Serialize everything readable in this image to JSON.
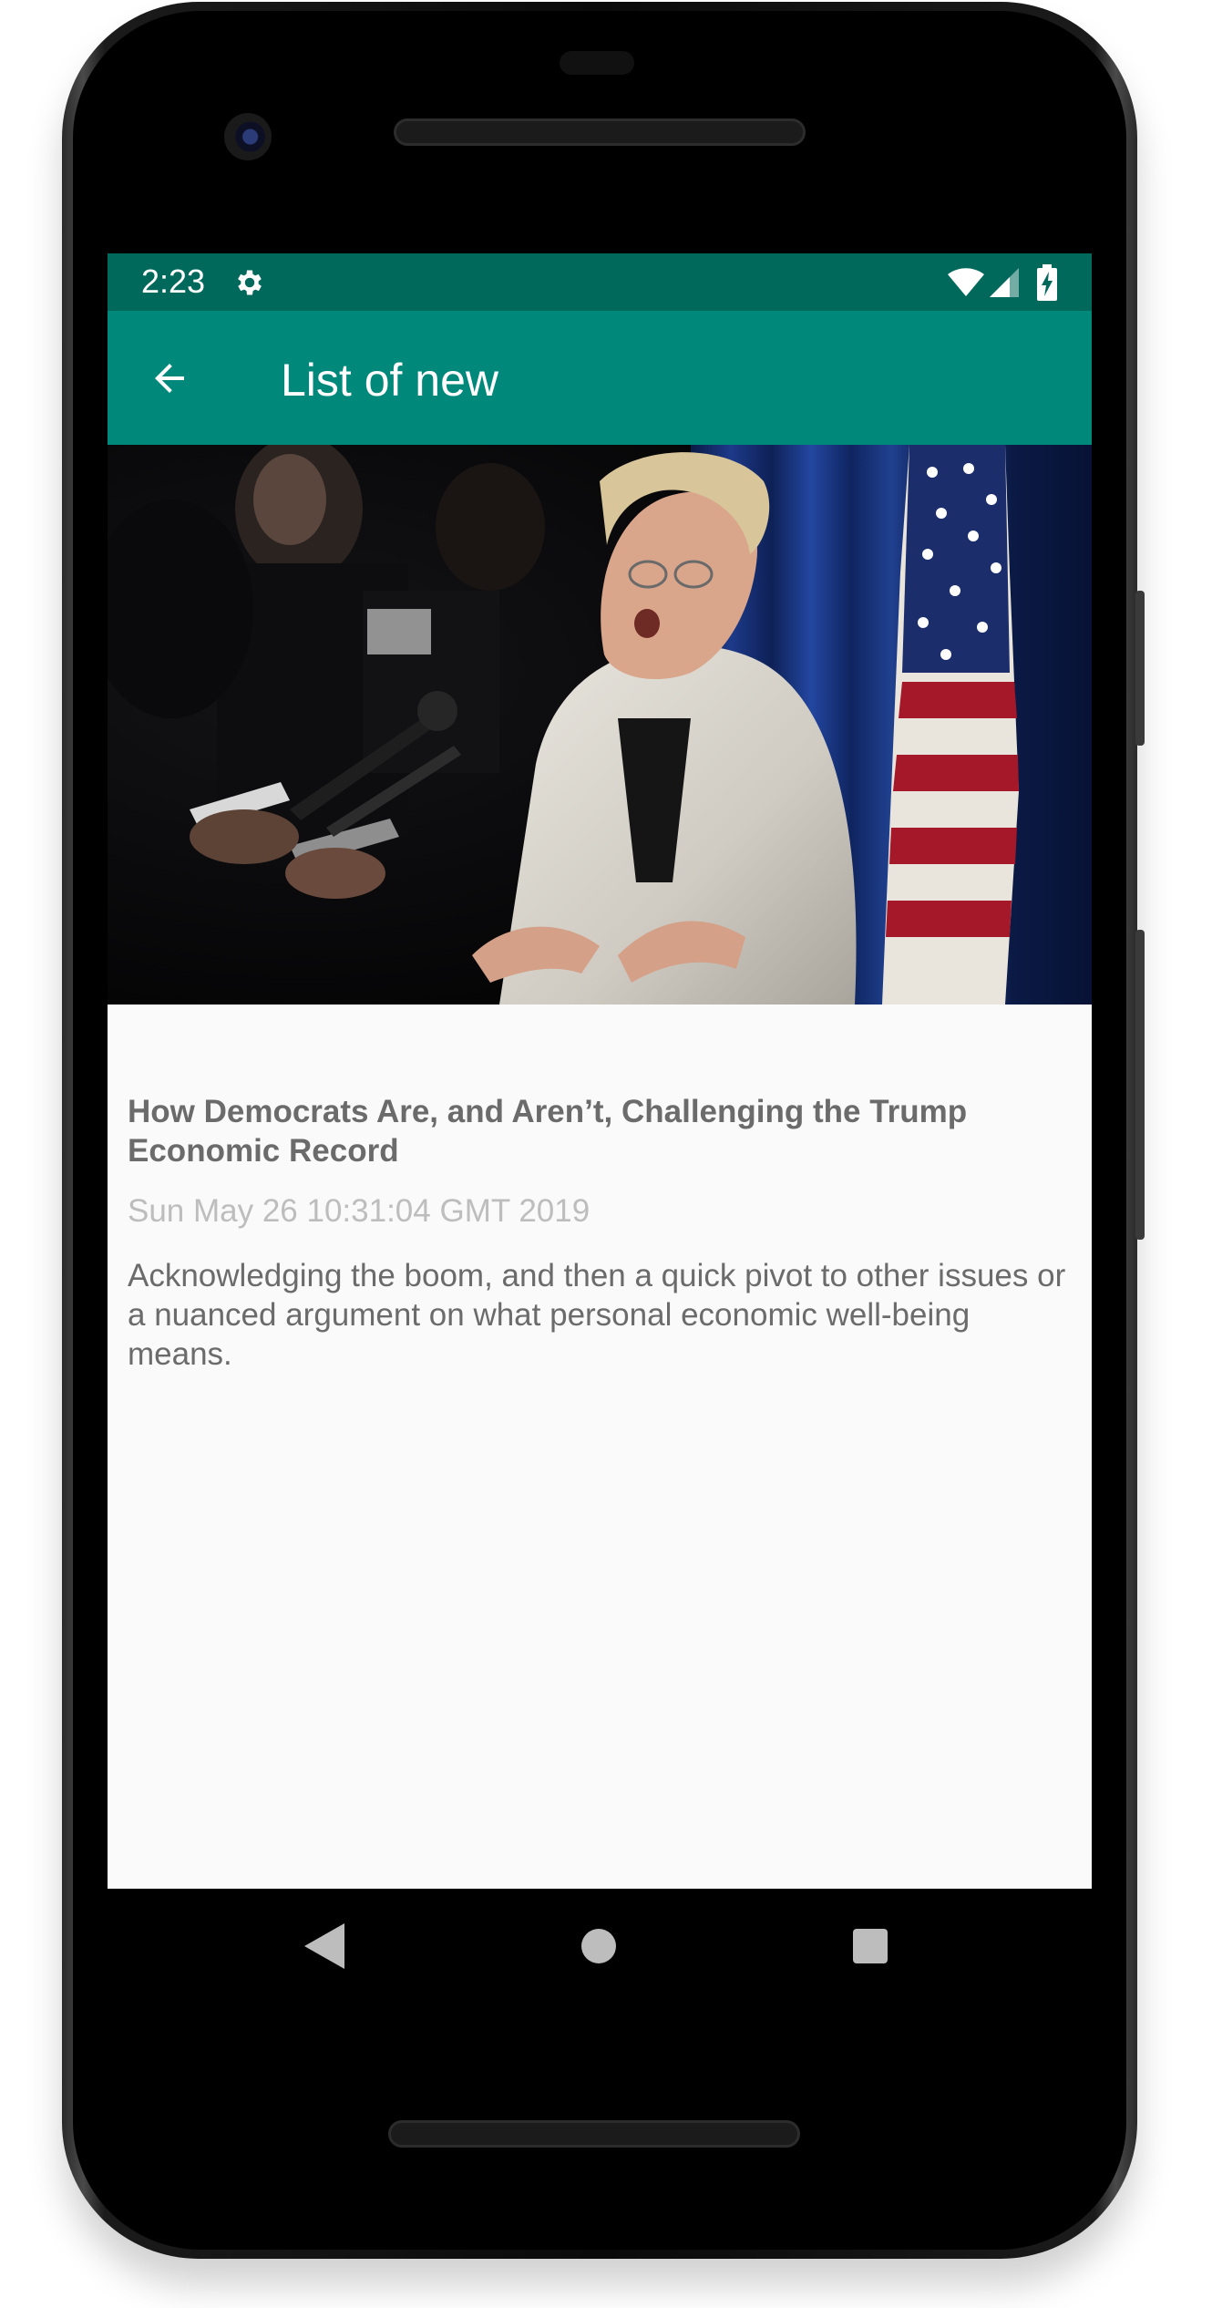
{
  "status_bar": {
    "time": "2:23",
    "icons": [
      "gear-icon",
      "wifi-icon",
      "cell-signal-icon",
      "battery-charging-icon"
    ],
    "background_color": "#00695c"
  },
  "app_bar": {
    "title": "List of new",
    "back_icon": "arrow-left-icon",
    "background_color": "#00897b"
  },
  "article": {
    "image": "photo of a woman speaking into microphones in front of an American flag",
    "title": "How Democrats Are, and Aren’t, Challenging the Trump Economic Record",
    "date": "Sun May 26 10:31:04 GMT 2019",
    "description": "Acknowledging the boom, and then a quick pivot to other issues or a nuanced argument on what personal economic well-being means."
  },
  "nav_bar": {
    "buttons": [
      "back-triangle-icon",
      "home-circle-icon",
      "recents-square-icon"
    ]
  }
}
